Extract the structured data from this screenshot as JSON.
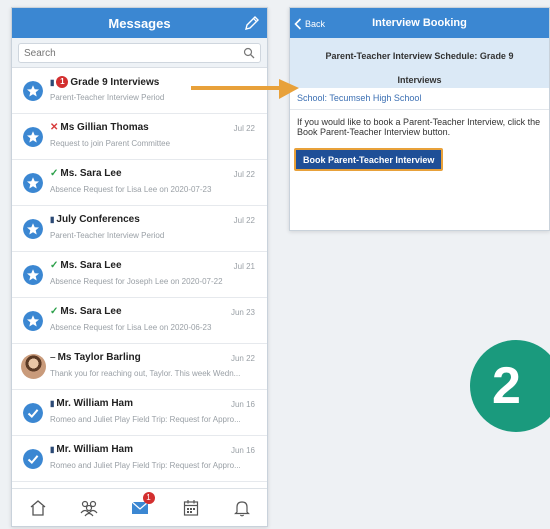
{
  "messages": {
    "title": "Messages",
    "search_placeholder": "Search",
    "items": [
      {
        "sender": "Grade 9 Interviews",
        "subtitle": "Parent-Teacher Interview Period",
        "date": "",
        "mark": "pin",
        "badge": "1"
      },
      {
        "sender": "Ms Gillian Thomas",
        "subtitle": "Request to join Parent Committee",
        "date": "Jul 22",
        "mark": "x"
      },
      {
        "sender": "Ms. Sara Lee",
        "subtitle": "Absence Request for Lisa Lee on 2020-07-23",
        "date": "Jul 22",
        "mark": "check"
      },
      {
        "sender": "July Conferences",
        "subtitle": "Parent-Teacher Interview Period",
        "date": "Jul 22",
        "mark": "pin"
      },
      {
        "sender": "Ms. Sara Lee",
        "subtitle": "Absence Request for Joseph Lee on 2020-07-22",
        "date": "Jul 21",
        "mark": "check"
      },
      {
        "sender": "Ms. Sara Lee",
        "subtitle": "Absence Request for Lisa Lee on 2020-06-23",
        "date": "Jun 23",
        "mark": "check"
      },
      {
        "sender": "Ms Taylor Barling",
        "subtitle": "Thank you for reaching out, Taylor. This week Wedn...",
        "date": "Jun 22",
        "mark": "dash",
        "photo": true
      },
      {
        "sender": "Mr. William Ham",
        "subtitle": "Romeo and Juliet Play Field Trip: Request for Appro...",
        "date": "Jun 16",
        "mark": "pin",
        "checked": true
      },
      {
        "sender": "Mr. William Ham",
        "subtitle": "Romeo and Juliet Play Field Trip: Request for Appro...",
        "date": "Jun 16",
        "mark": "pin",
        "checked": true
      }
    ],
    "tabs": [
      {
        "icon": "home-icon"
      },
      {
        "icon": "people-icon"
      },
      {
        "icon": "mail-icon",
        "badge": "1"
      },
      {
        "icon": "calendar-icon"
      },
      {
        "icon": "bell-icon"
      }
    ]
  },
  "booking": {
    "back_label": "Back",
    "title": "Interview Booking",
    "schedule_line1": "Parent-Teacher Interview Schedule: Grade 9",
    "schedule_line2": "Interviews",
    "school": "School: Tecumseh High School",
    "instructions": "If you would like to book a Parent-Teacher Interview, click the Book Parent-Teacher Interview button.",
    "book_button": "Book Parent-Teacher Interview"
  },
  "step_number": "2",
  "colors": {
    "header_blue": "#3b87d2",
    "button_navy": "#1f4f97",
    "highlight_orange": "#e8a13a",
    "step_green": "#1a9a7d",
    "badge_red": "#d32f2f"
  }
}
